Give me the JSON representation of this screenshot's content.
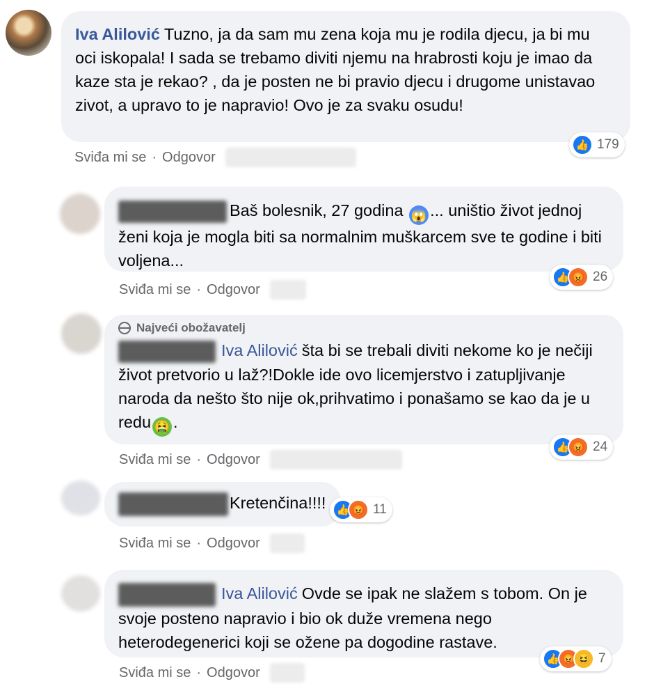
{
  "main_comment": {
    "author": "Iva Alilović",
    "text": "Tuzno, ja da sam mu zena koja mu je rodila djecu, ja bi mu oci iskopala! I sada se trebamo diviti njemu na hrabrosti koju je imao da kaze sta je rekao? , da je posten ne bi pravio djecu i drugome unistavao zivot, a upravo to je napravio! Ovo je za svaku osudu!",
    "reaction_count": "179",
    "actions": {
      "like": "Sviđa mi se",
      "reply": "Odgovor"
    }
  },
  "replies": [
    {
      "text_before": "Baš bolesnik, 27 godina",
      "emoji": "😱",
      "text_after": "... uništio život jednoj ženi koja je mogla biti sa normalnim muškarcem sve te godine i biti voljena...",
      "reaction_count": "26",
      "actions": {
        "like": "Sviđa mi se",
        "reply": "Odgovor"
      }
    },
    {
      "badge": "Najveći obožavatelj",
      "mention": "Iva Alilović",
      "text": "šta bi se trebali diviti nekome ko je nečiji život pretvorio u laž?!Dokle ide ovo licemjerstvo i zatupljivanje naroda da nešto što nije ok,prihvatimo i ponašamo se kao da je u redu",
      "emoji": "🤮",
      "text_end": ".",
      "reaction_count": "24",
      "actions": {
        "like": "Sviđa mi se",
        "reply": "Odgovor"
      }
    },
    {
      "text": "Kretenčina!!!!",
      "reaction_count": "11",
      "actions": {
        "like": "Sviđa mi se",
        "reply": "Odgovor"
      }
    },
    {
      "mention": "Iva Alilović",
      "text": "Ovde se ipak ne slažem s tobom. On je svoje posteno napravio i bio ok duže vremena nego heterodegenerici koji se ožene pa dogodine rastave.",
      "reaction_count": "7",
      "actions": {
        "like": "Sviđa mi se",
        "reply": "Odgovor"
      }
    }
  ],
  "colors": {
    "bubble": "#f0f2f5",
    "author": "#385898",
    "meta": "#65676b",
    "like": "#1877f2",
    "angry": "#f26d2a",
    "haha": "#f7b928"
  },
  "icons": [
    "user-avatar",
    "globe-icon",
    "like-reaction-icon",
    "angry-reaction-icon",
    "haha-reaction-icon"
  ]
}
